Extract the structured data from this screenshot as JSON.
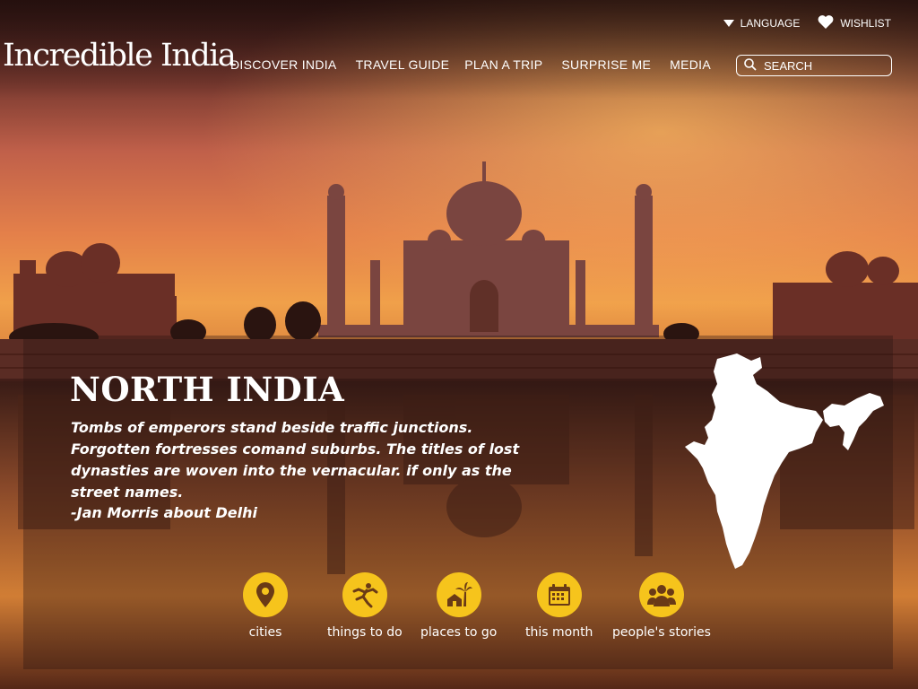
{
  "header": {
    "logo_text": "Incredible India",
    "language_label": "LANGUAGE",
    "wishlist_label": "WISHLIST",
    "nav": [
      "DISCOVER INDIA",
      "TRAVEL GUIDE",
      "PLAN A TRIP",
      "SURPRISE ME",
      "MEDIA"
    ],
    "search_placeholder": "SEARCH"
  },
  "hero": {
    "region_title": "NORTH INDIA",
    "quote": "Tombs of emperors stand beside traffic junctions. Forgotten fortresses comand suburbs. The titles of lost dynasties are woven into the vernacular. if only as the street names.",
    "attribution": "-Jan Morris about Delhi"
  },
  "features": [
    {
      "label": "cities",
      "icon": "map-pin-icon"
    },
    {
      "label": "things to do",
      "icon": "dancing-figure-icon"
    },
    {
      "label": "places to go",
      "icon": "palm-hut-icon"
    },
    {
      "label": "this month",
      "icon": "calendar-icon"
    },
    {
      "label": "people's stories",
      "icon": "people-group-icon"
    }
  ],
  "colors": {
    "accent_yellow": "#f6c41c",
    "text": "#ffffff"
  }
}
